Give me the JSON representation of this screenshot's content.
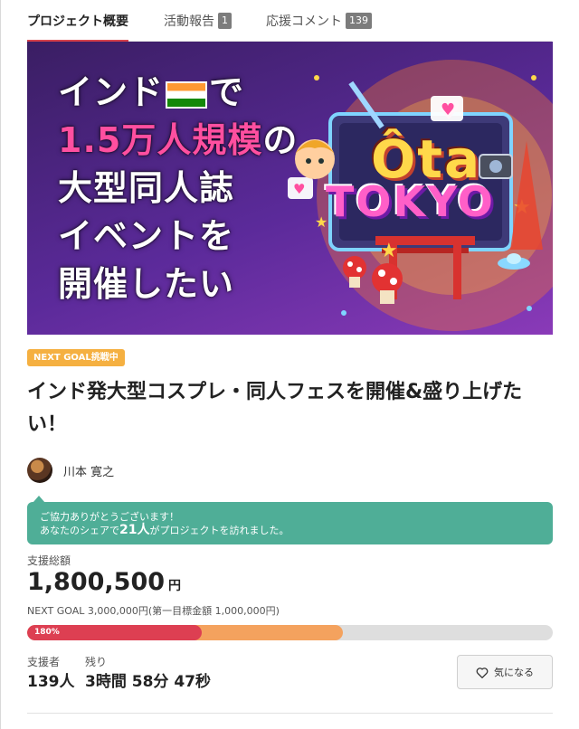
{
  "tabs": [
    {
      "label": "プロジェクト概要",
      "active": true
    },
    {
      "label": "活動報告",
      "badge": "1"
    },
    {
      "label": "応援コメント",
      "badge": "139"
    }
  ],
  "hero": {
    "lines": [
      "インド",
      "で",
      "1.5万人規模",
      "の",
      "大型同人誌",
      "イベントを",
      "開催したい"
    ],
    "logo_top": "Ôta",
    "logo_bottom": "TOKYO"
  },
  "goal_pill": "NEXT GOAL挑戦中",
  "title": "インド発大型コスプレ・同人フェスを開催&盛り上げたい！",
  "owner": {
    "name": "川本 寛之"
  },
  "share": {
    "line1": "ご協力ありがとうございます！",
    "line2_prefix": "あなたのシェアで",
    "line2_count": "21人",
    "line2_suffix": "がプロジェクトを訪れました。"
  },
  "funding": {
    "label": "支援総額",
    "amount": "1,800,500",
    "unit": "円",
    "next_goal": "NEXT GOAL 3,000,000円(第一目標金額 1,000,000円)",
    "percent_label": "180%",
    "first_goal_fraction": 0.333,
    "raised_fraction": 0.6
  },
  "stats": {
    "backers_label": "支援者",
    "backers_value": "139人",
    "remaining_label": "残り",
    "remaining_value": "3時間 58分 47秒"
  },
  "favorite_label": "気になる",
  "colors": {
    "accent": "#d6414b",
    "share_bubble": "#4fae97",
    "goal_pill": "#f5b041",
    "bar_red": "#dd3f52",
    "bar_orange": "#f4a25e"
  }
}
